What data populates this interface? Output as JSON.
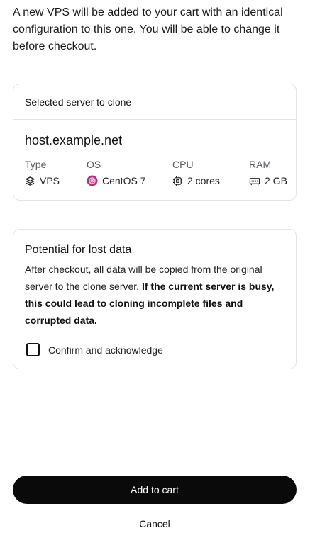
{
  "intro": {
    "text": "A new VPS will be added to your cart with an identical configuration to this one. You will be able to change it before checkout."
  },
  "server_card": {
    "header": "Selected server to clone",
    "hostname": "host.example.net",
    "specs": [
      {
        "label": "Type",
        "value": "VPS",
        "icon": "layers-icon"
      },
      {
        "label": "OS",
        "value": "CentOS 7",
        "icon": "centos-logo-icon"
      },
      {
        "label": "CPU",
        "value": "2 cores",
        "icon": "cpu-icon"
      },
      {
        "label": "RAM",
        "value": "2 GB",
        "icon": "memory-icon"
      }
    ]
  },
  "warning_card": {
    "title": "Potential for lost data",
    "body": "After checkout, all data will be copied from the original server to the clone server. ",
    "body_bold": "If the current server is busy, this could lead to cloning incomplete files and corrupted data.",
    "confirm_label": "Confirm and acknowledge",
    "confirm_checked": false
  },
  "actions": {
    "primary": "Add to cart",
    "cancel": "Cancel"
  },
  "colors": {
    "primary_button": "#0a0a0a",
    "border": "#e4e4e7",
    "centos_icon": "#b0307a"
  }
}
